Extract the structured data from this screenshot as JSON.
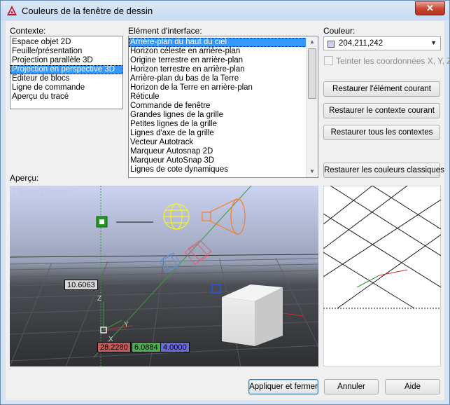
{
  "window": {
    "title": "Couleurs de la fenêtre de dessin",
    "close": "✕"
  },
  "context": {
    "label": "Contexte:",
    "items": [
      "Espace objet 2D",
      "Feuille/présentation",
      "Projection parallèle 3D",
      "Projection en perspective 3D",
      "Editeur de blocs",
      "Ligne de commande",
      "Aperçu du tracé"
    ],
    "selected": "Projection en perspective 3D"
  },
  "interface": {
    "label": "Elément d'interface:",
    "items": [
      "Arrière-plan du haut du ciel",
      "Horizon céleste en arrière-plan",
      "Origine terrestre en arrière-plan",
      "Horizon terrestre en arrière-plan",
      "Arrière-plan du bas de la Terre",
      "Horizon de la Terre en arrière-plan",
      "Réticule",
      "Commande de fenêtre",
      "Grandes lignes de la grille",
      "Petites lignes de la grille",
      "Lignes d'axe de la grille",
      "Vecteur Autotrack",
      "Marqueur Autosnap 2D",
      "Marqueur AutoSnap 3D",
      "Lignes de cote dynamiques"
    ],
    "selected": "Arrière-plan du haut du ciel"
  },
  "color": {
    "label": "Couleur:",
    "value": "204,211,242",
    "swatch": "#ccd3f2",
    "tint_label": "Teinter les coordonnées X, Y, Z",
    "tint_checked": false
  },
  "buttons": {
    "restore_element": "Restaurer l'élément courant",
    "restore_context": "Restaurer le contexte courant",
    "restore_all": "Restaurer tous les contextes",
    "restore_classic": "Restaurer les couleurs classiques",
    "apply_close": "Appliquer et fermer",
    "cancel": "Annuler",
    "help": "Aide"
  },
  "preview": {
    "label": "Aperçu:",
    "viewport_label": "[+][Haut][Rayon X]",
    "dim_value": "10.6063",
    "coord_x": "28.2280",
    "coord_y": "6.0884",
    "coord_z": "4.0000",
    "axis_z": "Z",
    "axis_y": "Y",
    "axis_x": "X",
    "colors": {
      "x_box": "#c85a5a",
      "y_box": "#4caf50",
      "z_box": "#6a6ad8"
    }
  }
}
